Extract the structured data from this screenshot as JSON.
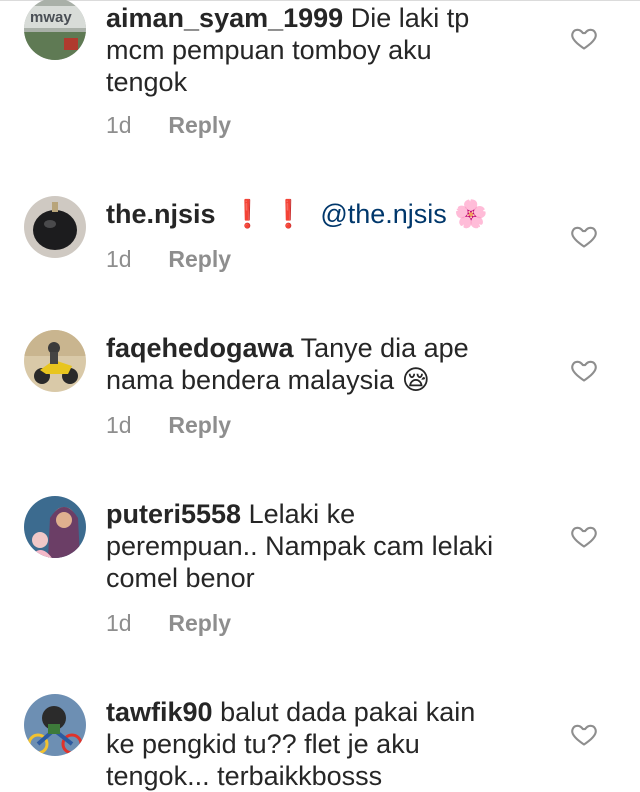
{
  "comments": [
    {
      "username": "aiman_syam_1999",
      "text": "Die laki tp",
      "line2": "mcm pempuan tomboy aku",
      "line3": "tengok",
      "time": "1d",
      "reply": "Reply",
      "avatar_text": "mway"
    },
    {
      "username": "the.njsis",
      "marks": "❗ ❗",
      "mention": "@the.njsis",
      "emoji": "🌸",
      "time": "1d",
      "reply": "Reply"
    },
    {
      "username": "faqehedogawa",
      "text": "Tanye dia ape",
      "line2": "nama bendera malaysia",
      "emoji": "😪",
      "time": "1d",
      "reply": "Reply"
    },
    {
      "username": "puteri5558",
      "text": "Lelaki ke",
      "line2": "perempuan.. Nampak cam lelaki",
      "line3": "comel benor",
      "time": "1d",
      "reply": "Reply"
    },
    {
      "username": "tawfik90",
      "text": "balut dada pakai kain",
      "line2": "ke pengkid tu?? flet je aku",
      "line3": "tengok... terbaikkbosss"
    }
  ],
  "colors": {
    "text": "#262626",
    "meta": "#8e8e8e",
    "mention": "#00376b",
    "heart_stroke": "#8e8e8e"
  },
  "icons": {
    "like": "heart-outline-icon"
  }
}
